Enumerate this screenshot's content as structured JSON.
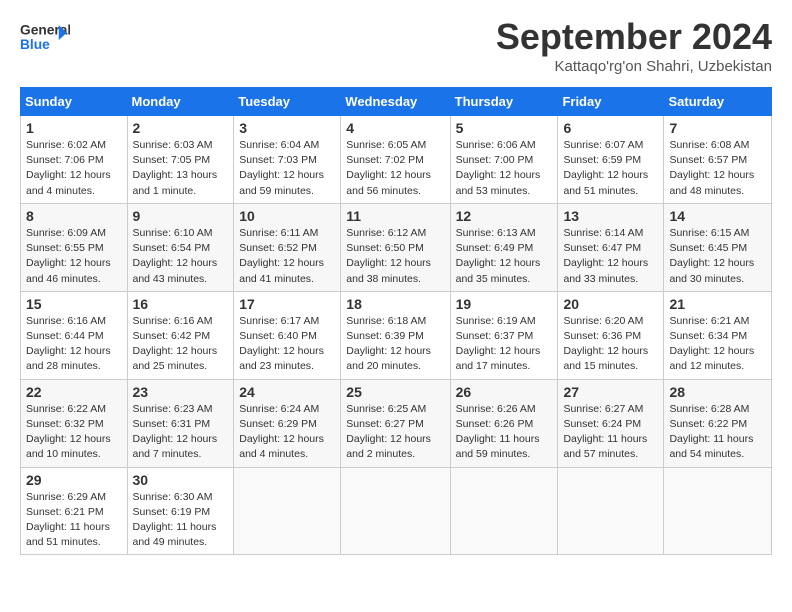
{
  "header": {
    "logo_line1": "General",
    "logo_line2": "Blue",
    "month_title": "September 2024",
    "subtitle": "Kattaqo'rg'on Shahri, Uzbekistan"
  },
  "days_of_week": [
    "Sunday",
    "Monday",
    "Tuesday",
    "Wednesday",
    "Thursday",
    "Friday",
    "Saturday"
  ],
  "weeks": [
    [
      {
        "day": "1",
        "sunrise": "6:02 AM",
        "sunset": "7:06 PM",
        "daylight": "12 hours and 4 minutes"
      },
      {
        "day": "2",
        "sunrise": "6:03 AM",
        "sunset": "7:05 PM",
        "daylight": "13 hours and 1 minute"
      },
      {
        "day": "3",
        "sunrise": "6:04 AM",
        "sunset": "7:03 PM",
        "daylight": "12 hours and 59 minutes"
      },
      {
        "day": "4",
        "sunrise": "6:05 AM",
        "sunset": "7:02 PM",
        "daylight": "12 hours and 56 minutes"
      },
      {
        "day": "5",
        "sunrise": "6:06 AM",
        "sunset": "7:00 PM",
        "daylight": "12 hours and 53 minutes"
      },
      {
        "day": "6",
        "sunrise": "6:07 AM",
        "sunset": "6:59 PM",
        "daylight": "12 hours and 51 minutes"
      },
      {
        "day": "7",
        "sunrise": "6:08 AM",
        "sunset": "6:57 PM",
        "daylight": "12 hours and 48 minutes"
      }
    ],
    [
      {
        "day": "8",
        "sunrise": "6:09 AM",
        "sunset": "6:55 PM",
        "daylight": "12 hours and 46 minutes"
      },
      {
        "day": "9",
        "sunrise": "6:10 AM",
        "sunset": "6:54 PM",
        "daylight": "12 hours and 43 minutes"
      },
      {
        "day": "10",
        "sunrise": "6:11 AM",
        "sunset": "6:52 PM",
        "daylight": "12 hours and 41 minutes"
      },
      {
        "day": "11",
        "sunrise": "6:12 AM",
        "sunset": "6:50 PM",
        "daylight": "12 hours and 38 minutes"
      },
      {
        "day": "12",
        "sunrise": "6:13 AM",
        "sunset": "6:49 PM",
        "daylight": "12 hours and 35 minutes"
      },
      {
        "day": "13",
        "sunrise": "6:14 AM",
        "sunset": "6:47 PM",
        "daylight": "12 hours and 33 minutes"
      },
      {
        "day": "14",
        "sunrise": "6:15 AM",
        "sunset": "6:45 PM",
        "daylight": "12 hours and 30 minutes"
      }
    ],
    [
      {
        "day": "15",
        "sunrise": "6:16 AM",
        "sunset": "6:44 PM",
        "daylight": "12 hours and 28 minutes"
      },
      {
        "day": "16",
        "sunrise": "6:16 AM",
        "sunset": "6:42 PM",
        "daylight": "12 hours and 25 minutes"
      },
      {
        "day": "17",
        "sunrise": "6:17 AM",
        "sunset": "6:40 PM",
        "daylight": "12 hours and 23 minutes"
      },
      {
        "day": "18",
        "sunrise": "6:18 AM",
        "sunset": "6:39 PM",
        "daylight": "12 hours and 20 minutes"
      },
      {
        "day": "19",
        "sunrise": "6:19 AM",
        "sunset": "6:37 PM",
        "daylight": "12 hours and 17 minutes"
      },
      {
        "day": "20",
        "sunrise": "6:20 AM",
        "sunset": "6:36 PM",
        "daylight": "12 hours and 15 minutes"
      },
      {
        "day": "21",
        "sunrise": "6:21 AM",
        "sunset": "6:34 PM",
        "daylight": "12 hours and 12 minutes"
      }
    ],
    [
      {
        "day": "22",
        "sunrise": "6:22 AM",
        "sunset": "6:32 PM",
        "daylight": "12 hours and 10 minutes"
      },
      {
        "day": "23",
        "sunrise": "6:23 AM",
        "sunset": "6:31 PM",
        "daylight": "12 hours and 7 minutes"
      },
      {
        "day": "24",
        "sunrise": "6:24 AM",
        "sunset": "6:29 PM",
        "daylight": "12 hours and 4 minutes"
      },
      {
        "day": "25",
        "sunrise": "6:25 AM",
        "sunset": "6:27 PM",
        "daylight": "12 hours and 2 minutes"
      },
      {
        "day": "26",
        "sunrise": "6:26 AM",
        "sunset": "6:26 PM",
        "daylight": "11 hours and 59 minutes"
      },
      {
        "day": "27",
        "sunrise": "6:27 AM",
        "sunset": "6:24 PM",
        "daylight": "11 hours and 57 minutes"
      },
      {
        "day": "28",
        "sunrise": "6:28 AM",
        "sunset": "6:22 PM",
        "daylight": "11 hours and 54 minutes"
      }
    ],
    [
      {
        "day": "29",
        "sunrise": "6:29 AM",
        "sunset": "6:21 PM",
        "daylight": "11 hours and 51 minutes"
      },
      {
        "day": "30",
        "sunrise": "6:30 AM",
        "sunset": "6:19 PM",
        "daylight": "11 hours and 49 minutes"
      },
      null,
      null,
      null,
      null,
      null
    ]
  ]
}
